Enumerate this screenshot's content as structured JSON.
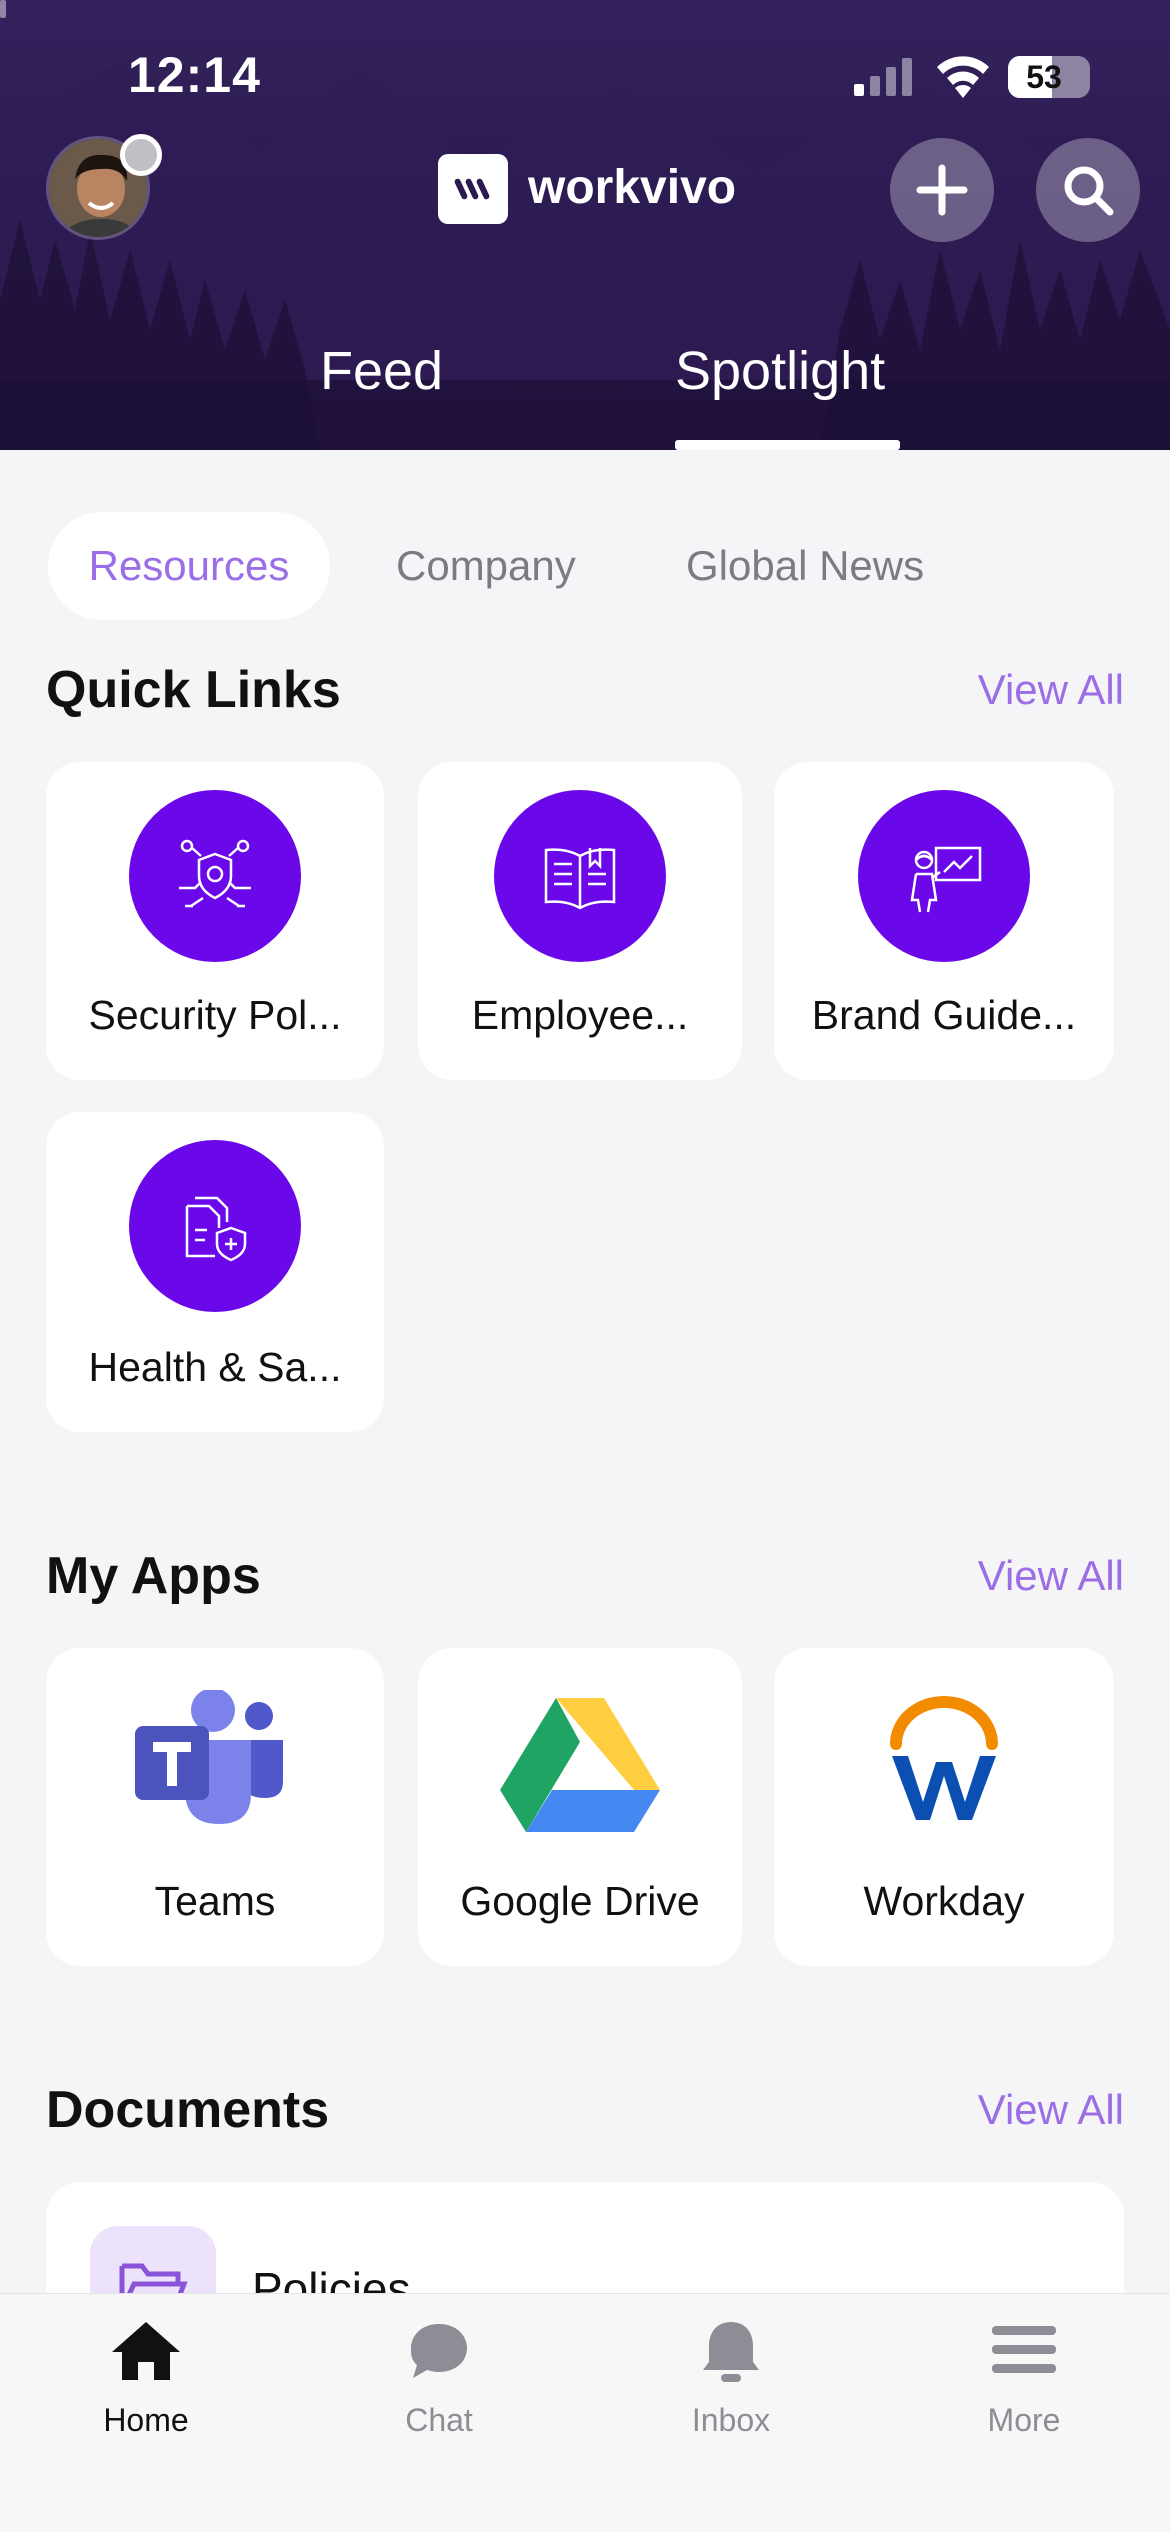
{
  "status_bar": {
    "time": "12:14",
    "battery": "53"
  },
  "header": {
    "brand": "workvivo",
    "tabs": [
      {
        "label": "Feed"
      },
      {
        "label": "Spotlight"
      }
    ],
    "active_tab": "Spotlight"
  },
  "segments": [
    {
      "label": "Resources",
      "active": true
    },
    {
      "label": "Company",
      "active": false
    },
    {
      "label": "Global News",
      "active": false
    }
  ],
  "quick_links": {
    "title": "Quick Links",
    "view_all": "View All",
    "items": [
      {
        "label": "Security Pol...",
        "icon": "security-policy-icon"
      },
      {
        "label": "Employee...",
        "icon": "book-icon"
      },
      {
        "label": "Brand Guide...",
        "icon": "presentation-icon"
      },
      {
        "label": "Health & Sa...",
        "icon": "document-shield-icon"
      }
    ]
  },
  "my_apps": {
    "title": "My Apps",
    "view_all": "View All",
    "items": [
      {
        "label": "Teams",
        "icon": "teams-icon"
      },
      {
        "label": "Google Drive",
        "icon": "google-drive-icon"
      },
      {
        "label": "Workday",
        "icon": "workday-icon"
      }
    ]
  },
  "documents": {
    "title": "Documents",
    "view_all": "View All",
    "items": [
      {
        "label": "Policies",
        "icon": "folder-icon"
      }
    ]
  },
  "tabbar": {
    "items": [
      {
        "label": "Home",
        "icon": "home-icon",
        "active": true
      },
      {
        "label": "Chat",
        "icon": "chat-icon",
        "active": false
      },
      {
        "label": "Inbox",
        "icon": "bell-icon",
        "active": false
      },
      {
        "label": "More",
        "icon": "menu-icon",
        "active": false
      }
    ]
  },
  "colors": {
    "accent": "#9b6de6",
    "icon_circle": "#6a08ea",
    "header": "#2a1a4f"
  }
}
